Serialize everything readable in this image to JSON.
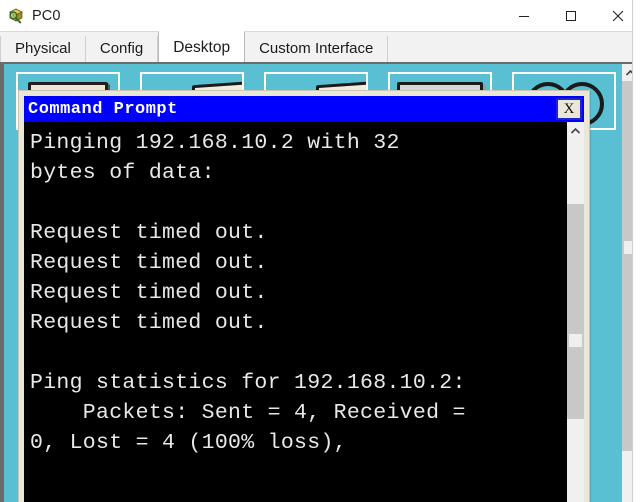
{
  "window": {
    "title": "PC0",
    "icon": "packet-tracer-pc-icon",
    "controls": {
      "minimize": "—",
      "maximize": "□",
      "close": "✕"
    }
  },
  "tabs": [
    {
      "label": "Physical",
      "active": false
    },
    {
      "label": "Config",
      "active": false
    },
    {
      "label": "Desktop",
      "active": true
    },
    {
      "label": "Custom Interface",
      "active": false
    }
  ],
  "desktop": {
    "background_color": "#59c0d4",
    "icons": [
      {
        "name": "desktop-icon-1"
      },
      {
        "name": "desktop-icon-2"
      },
      {
        "name": "desktop-icon-3"
      },
      {
        "name": "desktop-icon-4"
      },
      {
        "name": "desktop-icon-5"
      }
    ]
  },
  "command_prompt": {
    "title": "Command Prompt",
    "title_bar_color": "#0000ff",
    "close_label": "X",
    "terminal_background": "#000000",
    "terminal_foreground": "#e8e8e8",
    "lines": [
      "Pinging 192.168.10.2 with 32",
      "bytes of data:",
      "",
      "Request timed out.",
      "Request timed out.",
      "Request timed out.",
      "Request timed out.",
      "",
      "Ping statistics for 192.168.10.2:",
      "    Packets: Sent = 4, Received =",
      "0, Lost = 4 (100% loss),"
    ]
  },
  "scrollbars": {
    "up_arrow": "⌃"
  }
}
